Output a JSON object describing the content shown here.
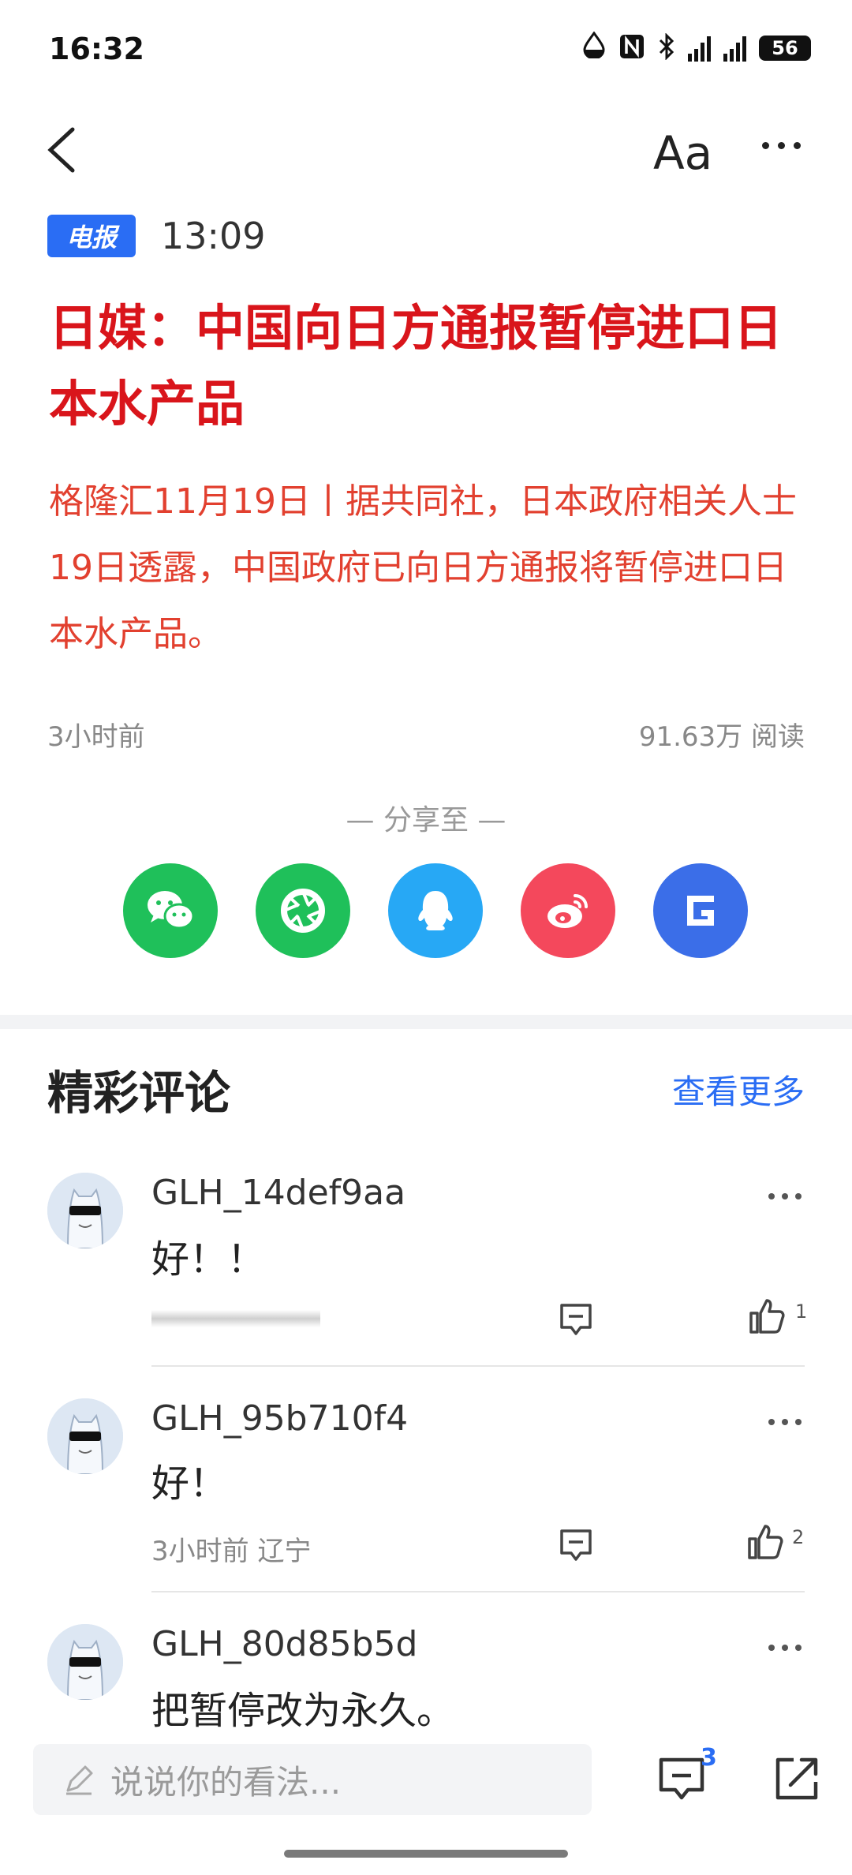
{
  "status_bar": {
    "time": "16:32",
    "battery": "56"
  },
  "nav": {
    "font_label": "Aa"
  },
  "article": {
    "tag": "电报",
    "time": "13:09",
    "headline": "日媒：中国向日方通报暂停进口日本水产品",
    "summary": "格隆汇11月19日丨据共同社，日本政府相关人士19日透露，中国政府已向日方通报将暂停进口日本水产品。",
    "published": "3小时前",
    "reads": "91.63万  阅读",
    "share_title": "— 分享至 —"
  },
  "share_targets": [
    {
      "name": "wechat",
      "color": "#1fc05a"
    },
    {
      "name": "moments",
      "color": "#1fc05a"
    },
    {
      "name": "qq",
      "color": "#27a8f5"
    },
    {
      "name": "weibo",
      "color": "#f4485c"
    },
    {
      "name": "gelonghui",
      "color": "#3b6ee8"
    }
  ],
  "comments_section": {
    "title": "精彩评论",
    "see_more": "查看更多"
  },
  "comments": [
    {
      "user": "GLH_14def9aa",
      "text": "好！！",
      "meta": "",
      "likes": "1"
    },
    {
      "user": "GLH_95b710f4",
      "text": "好！",
      "meta": "3小时前  辽宁",
      "likes": "2"
    },
    {
      "user": "GLH_80d85b5d",
      "text": "把暂停改为永久。",
      "meta": "",
      "likes": ""
    }
  ],
  "bottom_bar": {
    "input_placeholder": "说说你的看法...",
    "comment_count": "3"
  },
  "colors": {
    "accent": "#2a6df4",
    "headline": "#d9151b",
    "summary": "#e2402f"
  }
}
